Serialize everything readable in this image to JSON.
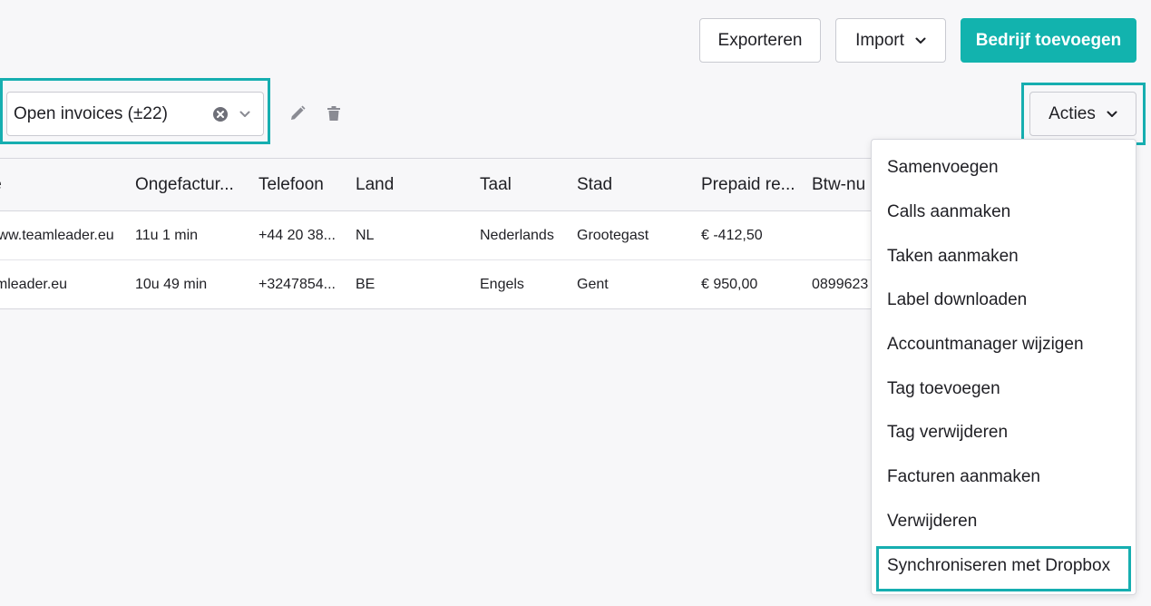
{
  "toolbar": {
    "export_label": "Exporteren",
    "import_label": "Import",
    "add_company_label": "Bedrijf toevoegen",
    "primary_color": "#12b3ae"
  },
  "filter": {
    "selected": "Open invoices (±22)",
    "icons": [
      "clear-icon",
      "chevron-down-icon",
      "pencil-icon",
      "trash-icon"
    ]
  },
  "actions": {
    "label": "Acties",
    "menu": [
      "Samenvoegen",
      "Calls aanmaken",
      "Taken aanmaken",
      "Label downloaden",
      "Accountmanager wijzigen",
      "Tag toevoegen",
      "Tag verwijderen",
      "Facturen aanmaken",
      "Verwijderen",
      "Synchroniseren met Dropbox"
    ],
    "selected_item": "Synchroniseren met Dropbox"
  },
  "table": {
    "columns": [
      "te",
      "Ongefactur...",
      "Telefoon",
      "Land",
      "Taal",
      "Stad",
      "Prepaid re...",
      "Btw-nu"
    ],
    "rows": [
      [
        "www.teamleader.eu",
        "11u 1 min",
        "+44 20 38...",
        "NL",
        "Nederlands",
        "Grootegast",
        "€ -412,50",
        ""
      ],
      [
        "amleader.eu",
        "10u 49 min",
        "+3247854...",
        "BE",
        "Engels",
        "Gent",
        "€ 950,00",
        "0899623"
      ]
    ]
  },
  "highlight_color": "#16aeb0"
}
